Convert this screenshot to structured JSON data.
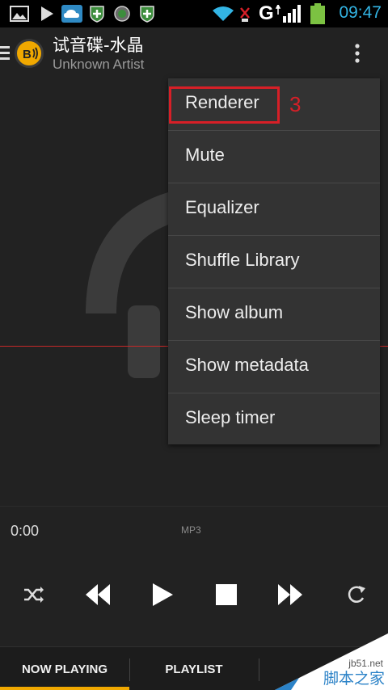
{
  "status_bar": {
    "time": "09:47",
    "network_label": "G",
    "icons": [
      "gallery-icon",
      "play-store-icon",
      "cloud-icon",
      "shield-plus-icon",
      "globe-icon",
      "shield-plus-icon",
      "wifi-icon",
      "no-sim-icon",
      "signal-icon",
      "battery-icon"
    ],
    "colors": {
      "time": "#33b5e5",
      "battery": "#7cc242"
    }
  },
  "header": {
    "title": "试音碟-水晶",
    "subtitle": "Unknown Artist",
    "logo_text": "B"
  },
  "menu": {
    "items": [
      {
        "label": "Renderer"
      },
      {
        "label": "Mute"
      },
      {
        "label": "Equalizer"
      },
      {
        "label": "Shuffle Library"
      },
      {
        "label": "Show album"
      },
      {
        "label": "Show metadata"
      },
      {
        "label": "Sleep timer"
      }
    ]
  },
  "annotation": {
    "label": "3",
    "color": "#d71f27"
  },
  "player": {
    "time": "0:00",
    "format": "MP3",
    "controls": [
      "shuffle-icon",
      "rewind-icon",
      "play-icon",
      "stop-icon",
      "fast-forward-icon",
      "repeat-icon"
    ]
  },
  "tabs": [
    {
      "label": "NOW PLAYING",
      "active": true
    },
    {
      "label": "PLAYLIST",
      "active": false
    }
  ],
  "accent_color": "#f0a800",
  "watermark": {
    "line1": "jb51.net",
    "line2": "脚本之家"
  }
}
